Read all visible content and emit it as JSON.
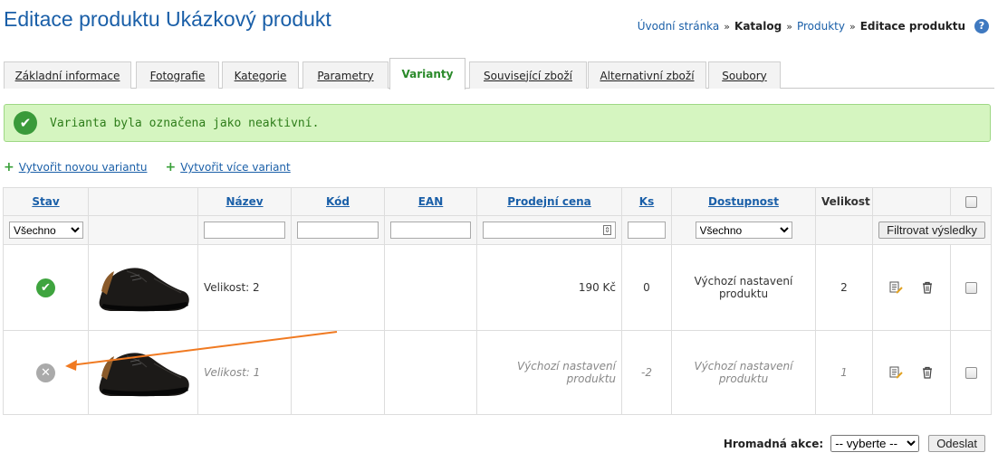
{
  "header": {
    "title": "Editace produktu Ukázkový produkt",
    "breadcrumb": {
      "home": "Úvodní stránka",
      "catalog": "Katalog",
      "products": "Produkty",
      "current": "Editace produktu",
      "separator": "»"
    },
    "help_icon": "?"
  },
  "tabs": [
    {
      "label": "Základní informace"
    },
    {
      "label": "Fotografie"
    },
    {
      "label": "Kategorie"
    },
    {
      "label": "Parametry"
    },
    {
      "label": "Varianty",
      "active": true
    },
    {
      "label": "Související zboží"
    },
    {
      "label": "Alternativní zboží"
    },
    {
      "label": "Soubory"
    }
  ],
  "alert": {
    "message": "Varianta byla označena jako neaktivní.",
    "icon": "check-circle-icon",
    "color": "#d5f5c0"
  },
  "actions": {
    "create_one": "Vytvořit novou variantu",
    "create_many": "Vytvořit více variant"
  },
  "table": {
    "headers": {
      "stav": "Stav",
      "nazev": "Název",
      "kod": "Kód",
      "ean": "EAN",
      "cena": "Prodejní cena",
      "ks": "Ks",
      "dostupnost": "Dostupnost",
      "velikost": "Velikost"
    },
    "filters": {
      "stav": "Všechno",
      "dostupnost": "Všechno",
      "button": "Filtrovat výsledky"
    },
    "rows": [
      {
        "status": "active",
        "status_icon": "check-circle-icon",
        "name": "Velikost: 2",
        "code": "",
        "ean": "",
        "price": "190 Kč",
        "qty": "0",
        "availability": "Výchozí nastavení produktu",
        "size": "2"
      },
      {
        "status": "inactive",
        "status_icon": "x-circle-icon",
        "name": "Velikost: 1",
        "code": "",
        "ean": "",
        "price": "Výchozí nastavení produktu",
        "qty": "-2",
        "availability": "Výchozí nastavení produktu",
        "size": "1"
      }
    ]
  },
  "bulk": {
    "label": "Hromadná akce:",
    "select": "-- vyberte --",
    "submit": "Odeslat"
  },
  "colors": {
    "link": "#1a5fa8",
    "active_tab": "#2a8a2a",
    "annotation_arrow": "#f07a22"
  }
}
